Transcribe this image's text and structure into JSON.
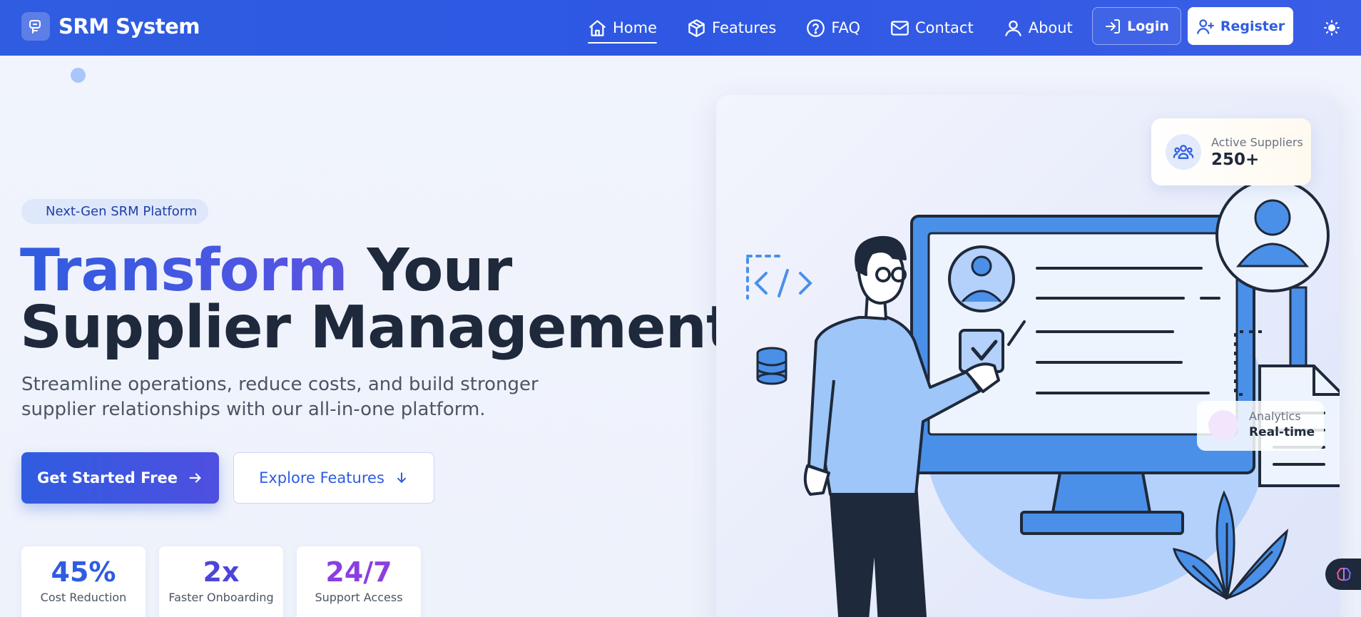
{
  "brand": {
    "name": "SRM System"
  },
  "nav": {
    "items": [
      {
        "label": "Home",
        "icon": "home-icon",
        "active": true
      },
      {
        "label": "Features",
        "icon": "box-icon",
        "active": false
      },
      {
        "label": "FAQ",
        "icon": "help-circle-icon",
        "active": false
      },
      {
        "label": "Contact",
        "icon": "mail-icon",
        "active": false
      },
      {
        "label": "About",
        "icon": "user-icon",
        "active": false
      }
    ],
    "login_label": "Login",
    "register_label": "Register",
    "theme_icon": "sun-icon"
  },
  "hero": {
    "badge": "Next-Gen SRM Platform",
    "title_accent": "Transform",
    "title_rest_1": " Your",
    "title_line_2": "Supplier Management",
    "subtitle": "Streamline operations, reduce costs, and build stronger supplier relationships with our all-in-one platform.",
    "primary_cta": "Get Started Free",
    "secondary_cta": "Explore Features",
    "stats": [
      {
        "value": "45%",
        "label": "Cost Reduction",
        "color": "#2f5ce0"
      },
      {
        "value": "2x",
        "label": "Faster Onboarding",
        "color": "#4d45d8"
      },
      {
        "value": "24/7",
        "label": "Support Access",
        "color": "#8a3fe0"
      }
    ]
  },
  "illustration": {
    "active_suppliers": {
      "label": "Active Suppliers",
      "value": "250+"
    },
    "analytics_card": {
      "label": "Analytics",
      "value": "Real-time"
    }
  },
  "colors": {
    "nav_bg": "#2f5ce0",
    "accent": "#2f5ce0",
    "illustration_blue": "#4a90e8"
  }
}
